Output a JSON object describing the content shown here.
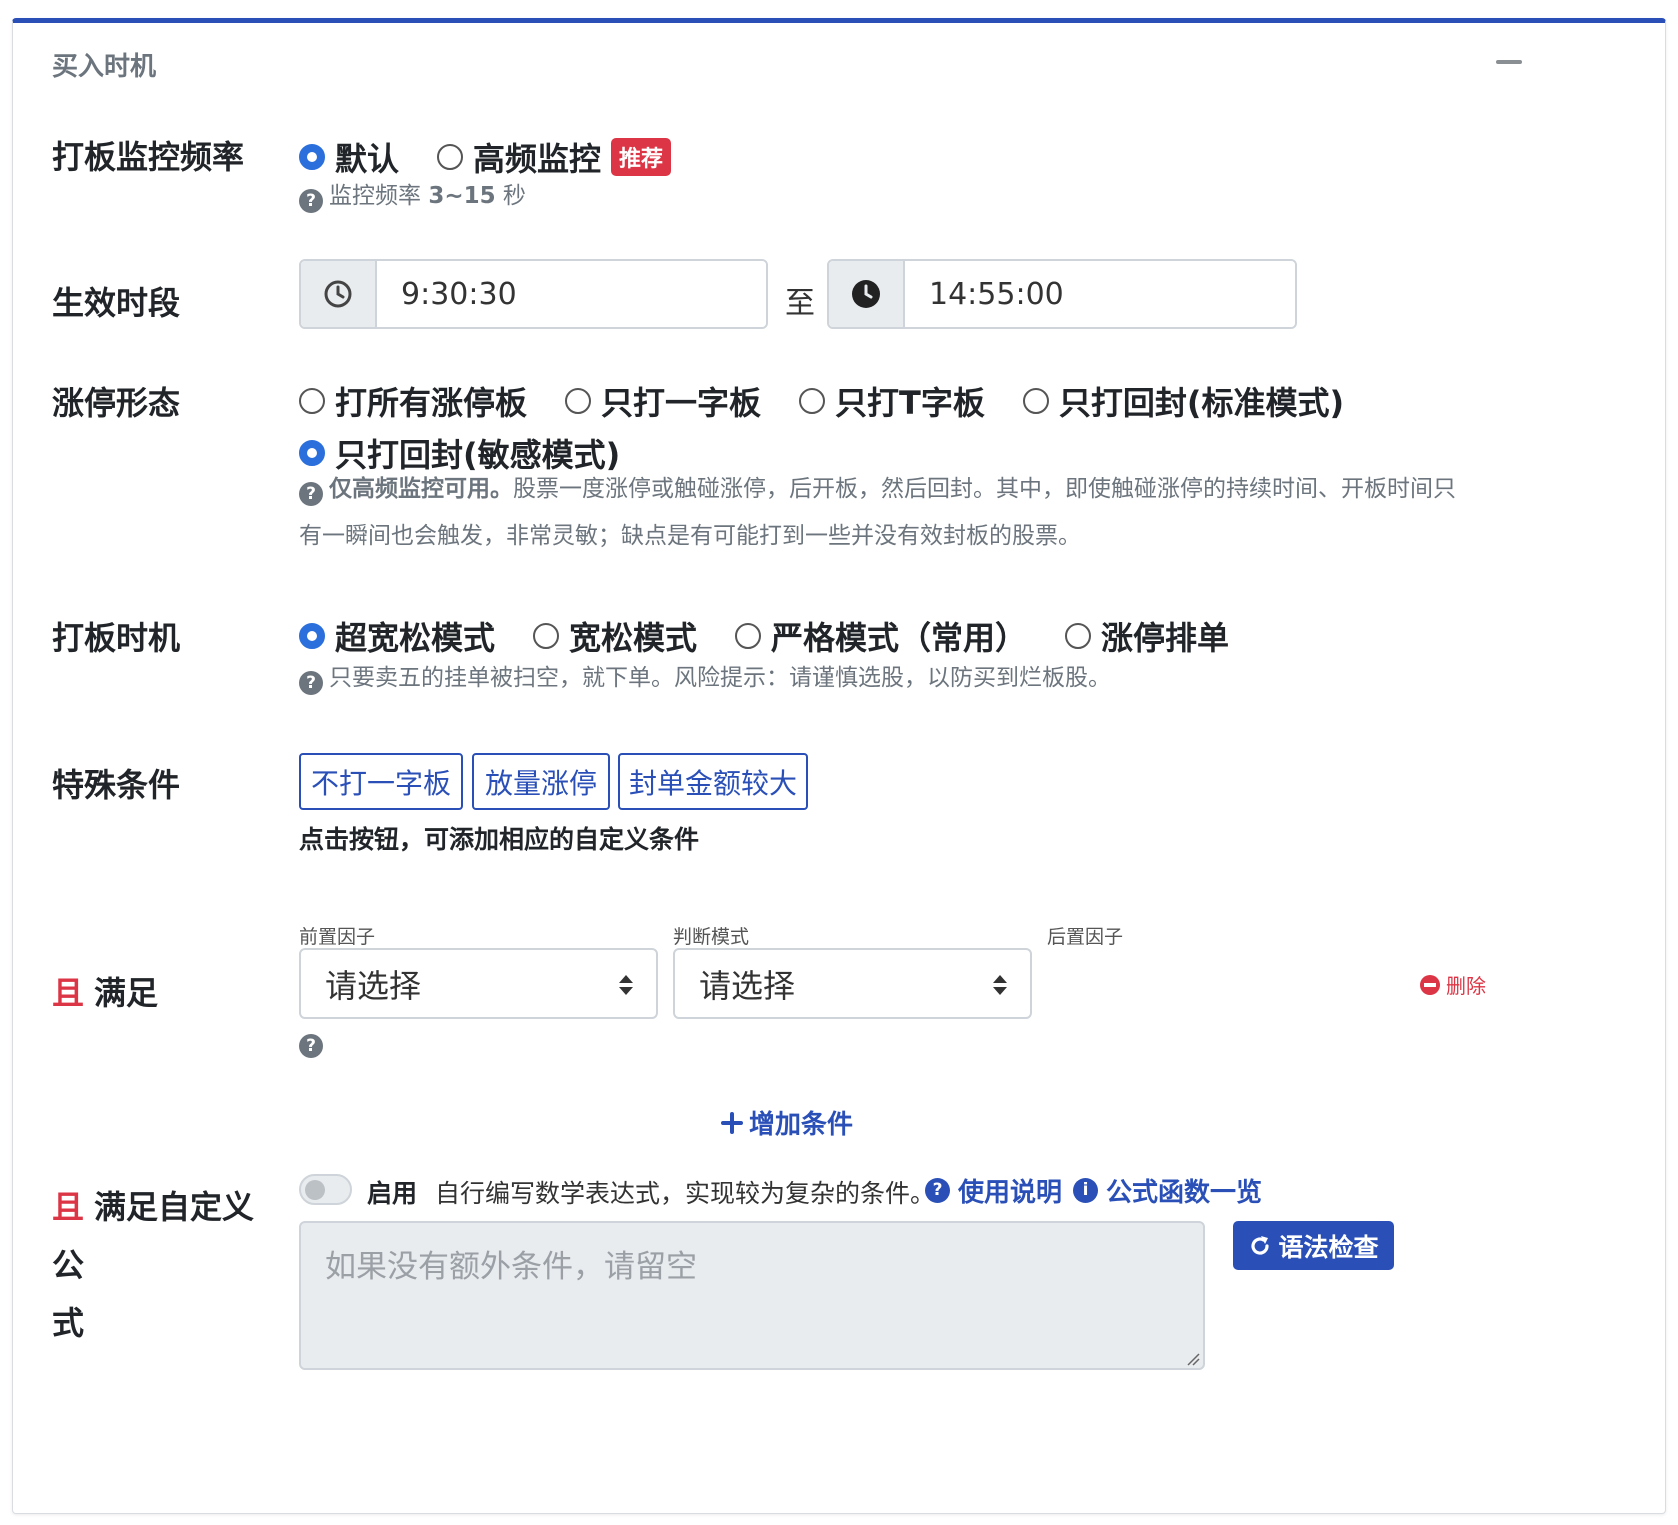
{
  "panel": {
    "title": "买入时机"
  },
  "monitor_freq": {
    "label": "打板监控频率",
    "options": [
      "默认",
      "高频监控"
    ],
    "selected": "默认",
    "badge": "推荐",
    "hint_prefix": "监控频率 ",
    "hint_value": "3~15",
    "hint_suffix": " 秒"
  },
  "active_period": {
    "label": "生效时段",
    "start": "9:30:30",
    "separator": "至",
    "end": "14:55:00"
  },
  "limit_shape": {
    "label": "涨停形态",
    "options": [
      "打所有涨停板",
      "只打一字板",
      "只打T字板",
      "只打回封(标准模式)",
      "只打回封(敏感模式)"
    ],
    "selected": "只打回封(敏感模式)",
    "hint_bold": "仅高频监控可用。",
    "hint_line1": "股票一度涨停或触碰涨停，后开板，然后回封。其中，即使触碰涨停的持续时间、开板时间只",
    "hint_line2": "有一瞬间也会触发，非常灵敏；缺点是有可能打到一些并没有效封板的股票。"
  },
  "timing": {
    "label": "打板时机",
    "options": [
      "超宽松模式",
      "宽松模式",
      "严格模式（常用）",
      "涨停排单"
    ],
    "selected": "超宽松模式",
    "hint": "只要卖五的挂单被扫空，就下单。风险提示：请谨慎选股，以防买到烂板股。"
  },
  "special": {
    "label": "特殊条件",
    "buttons": [
      "不打一字板",
      "放量涨停",
      "封单金额较大"
    ],
    "note": "点击按钮，可添加相应的自定义条件"
  },
  "condition": {
    "and": "且",
    "label": "满足",
    "pre_factor_label": "前置因子",
    "mode_label": "判断模式",
    "post_factor_label": "后置因子",
    "pre_factor_value": "请选择",
    "mode_value": "请选择",
    "delete": "删除",
    "add": "增加条件"
  },
  "custom_formula": {
    "and": "且",
    "label_line1": "满足自定义公",
    "label_line2": "式",
    "toggle_label": "启用",
    "toggle_on": false,
    "description": "自行编写数学表达式，实现较为复杂的条件。",
    "help_link": "使用说明",
    "functions_link": "公式函数一览",
    "placeholder": "如果没有额外条件，请留空",
    "check_button": "语法检查"
  },
  "colors": {
    "primary": "#2a50b8",
    "danger": "#dc3545",
    "radio_checked": "#2a6fdb"
  },
  "icons": [
    "clock-outline-icon",
    "clock-solid-icon",
    "question-circle-icon",
    "plus-icon",
    "minus-circle-icon",
    "info-circle-icon",
    "redo-icon",
    "sort-arrows-icon"
  ]
}
